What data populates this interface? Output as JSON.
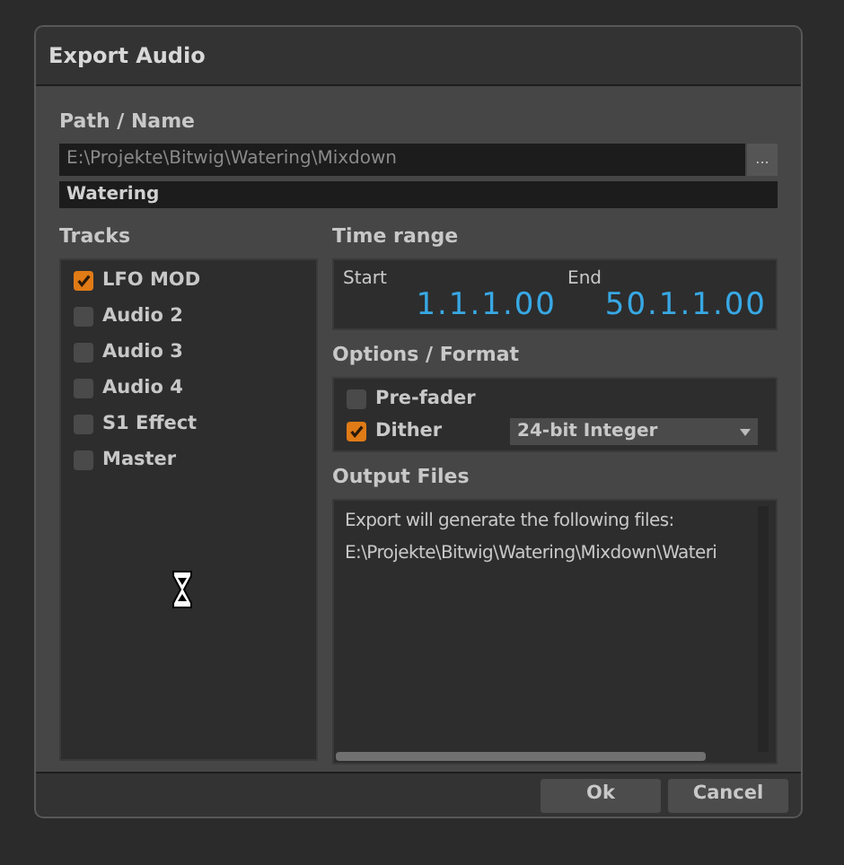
{
  "window": {
    "title": "Export Audio"
  },
  "path_name": {
    "label": "Path / Name",
    "path": "E:\\Projekte\\Bitwig\\Watering\\Mixdown",
    "browse": "...",
    "name": "Watering"
  },
  "tracks": {
    "label": "Tracks",
    "items": [
      {
        "name": "LFO MOD",
        "checked": true
      },
      {
        "name": "Audio 2",
        "checked": false
      },
      {
        "name": "Audio 3",
        "checked": false
      },
      {
        "name": "Audio 4",
        "checked": false
      },
      {
        "name": "S1 Effect",
        "checked": false
      },
      {
        "name": "Master",
        "checked": false
      }
    ]
  },
  "time_range": {
    "label": "Time range",
    "start_label": "Start",
    "start": "1.1.1.00",
    "end_label": "End",
    "end": "50.1.1.00"
  },
  "options": {
    "label": "Options / Format",
    "items": [
      {
        "kind": "checkbox",
        "name": "Pre-fader",
        "checked": false
      },
      {
        "kind": "checkbox-select",
        "name": "Dither",
        "checked": true,
        "value": "24-bit Integer"
      }
    ]
  },
  "output_files": {
    "label": "Output Files",
    "lines": [
      "Export will generate the following files:",
      "E:\\Projekte\\Bitwig\\Watering\\Mixdown\\Wateri"
    ]
  },
  "buttons": [
    "Ok",
    "Cancel"
  ]
}
